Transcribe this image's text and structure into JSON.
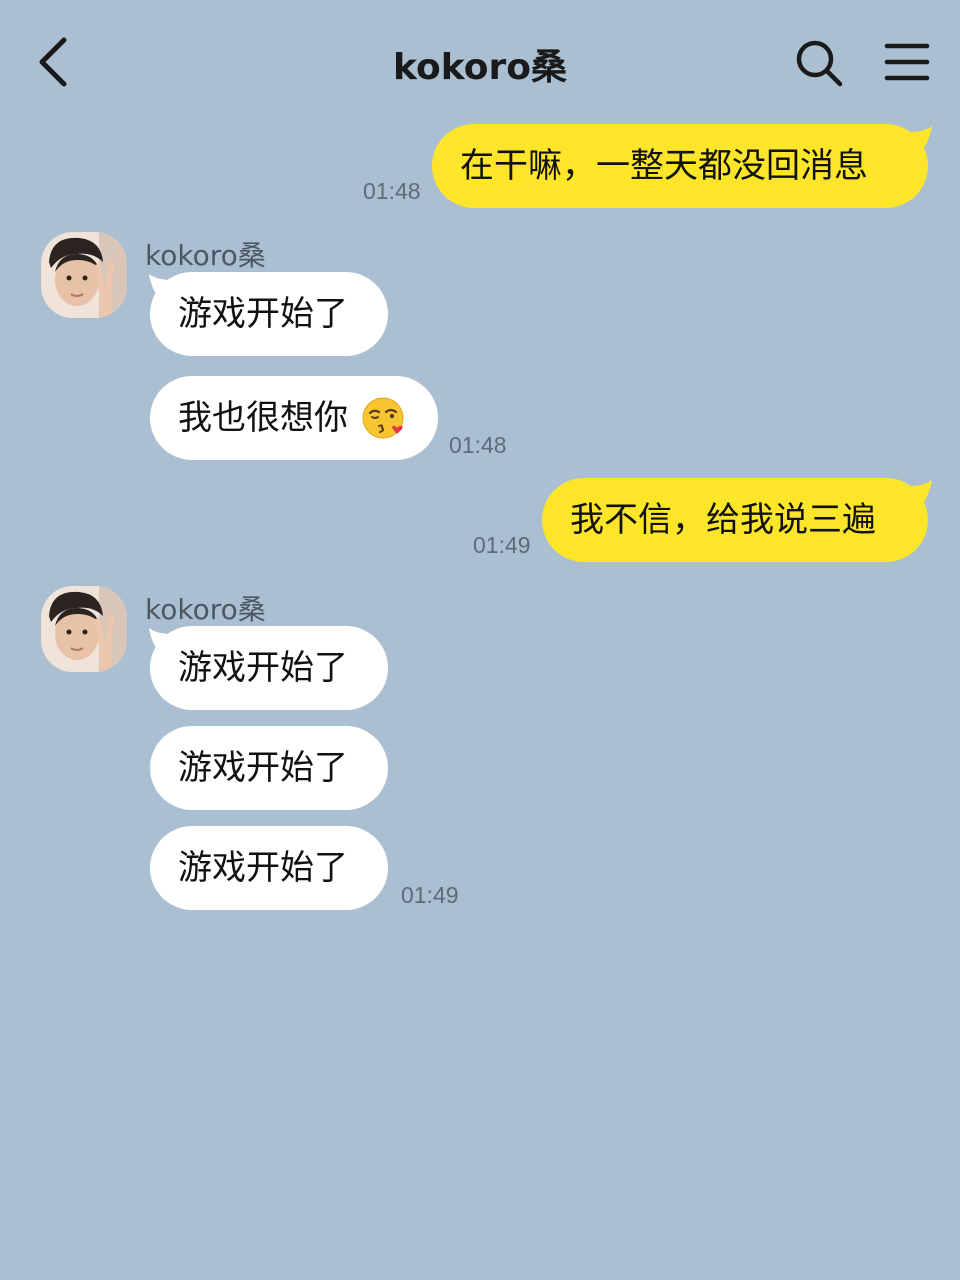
{
  "header": {
    "title": "kokoro桑"
  },
  "messages": {
    "m1": {
      "text": "在干嘛，一整天都没回消息",
      "time": "01:48"
    },
    "g1": {
      "sender": "kokoro桑",
      "b1": "游戏开始了",
      "b2": "我也很想你",
      "b2_emoji": "face-blowing-a-kiss-emoji",
      "time": "01:48"
    },
    "m2": {
      "text": "我不信，给我说三遍",
      "time": "01:49"
    },
    "g2": {
      "sender": "kokoro桑",
      "b1": "游戏开始了",
      "b2": "游戏开始了",
      "b3": "游戏开始了",
      "time": "01:49"
    }
  },
  "icons": {
    "back": "chevron-left-icon",
    "search": "search-icon",
    "menu": "hamburger-menu-icon"
  },
  "colors": {
    "background": "#abbfd2",
    "outgoing_bubble": "#fde52a",
    "incoming_bubble": "#ffffff"
  }
}
